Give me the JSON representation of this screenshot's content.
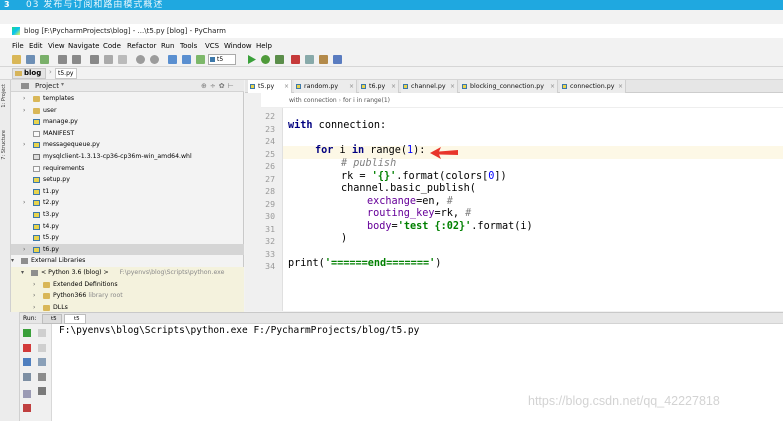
{
  "banner": {
    "number": "3",
    "text": "03 发布与订阅和路由模式概述"
  },
  "window": {
    "title": "blog [F:\\PycharmProjects\\blog] - ...\\t5.py [blog] - PyCharm"
  },
  "menu": [
    "File",
    "Edit",
    "View",
    "Navigate",
    "Code",
    "Refactor",
    "Run",
    "Tools",
    "VCS",
    "Window",
    "Help"
  ],
  "toolbar": {
    "run_config": "t5"
  },
  "navbar": {
    "project": "blog",
    "file": "t5.py"
  },
  "left_stripe": {
    "project": "1: Project",
    "structure": "7: Structure"
  },
  "project_panel": {
    "title": "Project",
    "tree": [
      {
        "label": "templates",
        "type": "folder",
        "arrow": true
      },
      {
        "label": "user",
        "type": "folder",
        "arrow": true
      },
      {
        "label": "manage.py",
        "type": "py"
      },
      {
        "label": "MANIFEST",
        "type": "file"
      },
      {
        "label": "messagequeue.py",
        "type": "py",
        "arrow": true
      },
      {
        "label": "mysqlclient-1.3.13-cp36-cp36m-win_amd64.whl",
        "type": "whl"
      },
      {
        "label": "requirements",
        "type": "file"
      },
      {
        "label": "setup.py",
        "type": "py"
      },
      {
        "label": "t1.py",
        "type": "py"
      },
      {
        "label": "t2.py",
        "type": "py",
        "arrow": true
      },
      {
        "label": "t3.py",
        "type": "py"
      },
      {
        "label": "t4.py",
        "type": "py"
      },
      {
        "label": "t5.py",
        "type": "py"
      },
      {
        "label": "t6.py",
        "type": "py",
        "arrow": true,
        "selected": true
      },
      {
        "label": "External Libraries",
        "type": "lib",
        "arrow": true,
        "open": true
      },
      {
        "label": "< Python 3.6 (blog) >",
        "sub": "F:\\pyenvs\\blog\\Scripts\\python.exe",
        "type": "lib",
        "arrow": true,
        "open": true
      },
      {
        "label": "Extended Definitions",
        "type": "folder",
        "arrow": true
      },
      {
        "label": "Python366",
        "sub": "library root",
        "type": "folder",
        "arrow": true
      },
      {
        "label": "DLLs",
        "type": "folder",
        "arrow": true
      }
    ]
  },
  "tabs": [
    {
      "label": "t5.py",
      "active": true
    },
    {
      "label": "random.py"
    },
    {
      "label": "t6.py"
    },
    {
      "label": "channel.py"
    },
    {
      "label": "blocking_connection.py"
    },
    {
      "label": "connection.py"
    }
  ],
  "editor": {
    "breadcrumb": [
      "with connection",
      "for i in range(1)"
    ],
    "line_numbers": [
      "22",
      "23",
      "24",
      "25",
      "26",
      "27",
      "28",
      "29",
      "30",
      "31",
      "32",
      "33",
      "34"
    ],
    "code": {
      "l23_kw": "with",
      "l23_rest": " connection:",
      "l25_for": "for",
      "l25_i": " i ",
      "l25_in": "in",
      "l25_range": " range(",
      "l25_num": "1",
      "l25_close": "):",
      "l26": "# publish",
      "l27_a": "rk = ",
      "l27_str": "'{}'",
      "l27_b": ".format(colors[",
      "l27_num": "0",
      "l27_c": "])",
      "l28": "channel.basic_publish(",
      "l29_kw": "exchange",
      "l29_rest": "=en, ",
      "l29_cmt": "#",
      "l30_kw": "routing_key",
      "l30_rest": "=rk, ",
      "l30_cmt": "#",
      "l31_kw": "body",
      "l31_eq": "=",
      "l31_str": "'test {:02}'",
      "l31_rest": ".format(i)",
      "l32": ")",
      "l34_a": "print(",
      "l34_str": "'======end======='",
      "l34_b": ")"
    }
  },
  "run": {
    "label": "Run:",
    "tab1": "t5",
    "tab2": "t5",
    "command": "F:\\pyenvs\\blog\\Scripts\\python.exe F:/PycharmProjects/blog/t5.py"
  },
  "watermark": "https://blog.csdn.net/qq_42227818",
  "colors": {
    "banner": "#1fa8e0",
    "keyword": "#000080",
    "string": "#008000",
    "kwarg": "#660099",
    "comment": "#808080",
    "number": "#0000ff",
    "arrow": "#e8352b"
  }
}
